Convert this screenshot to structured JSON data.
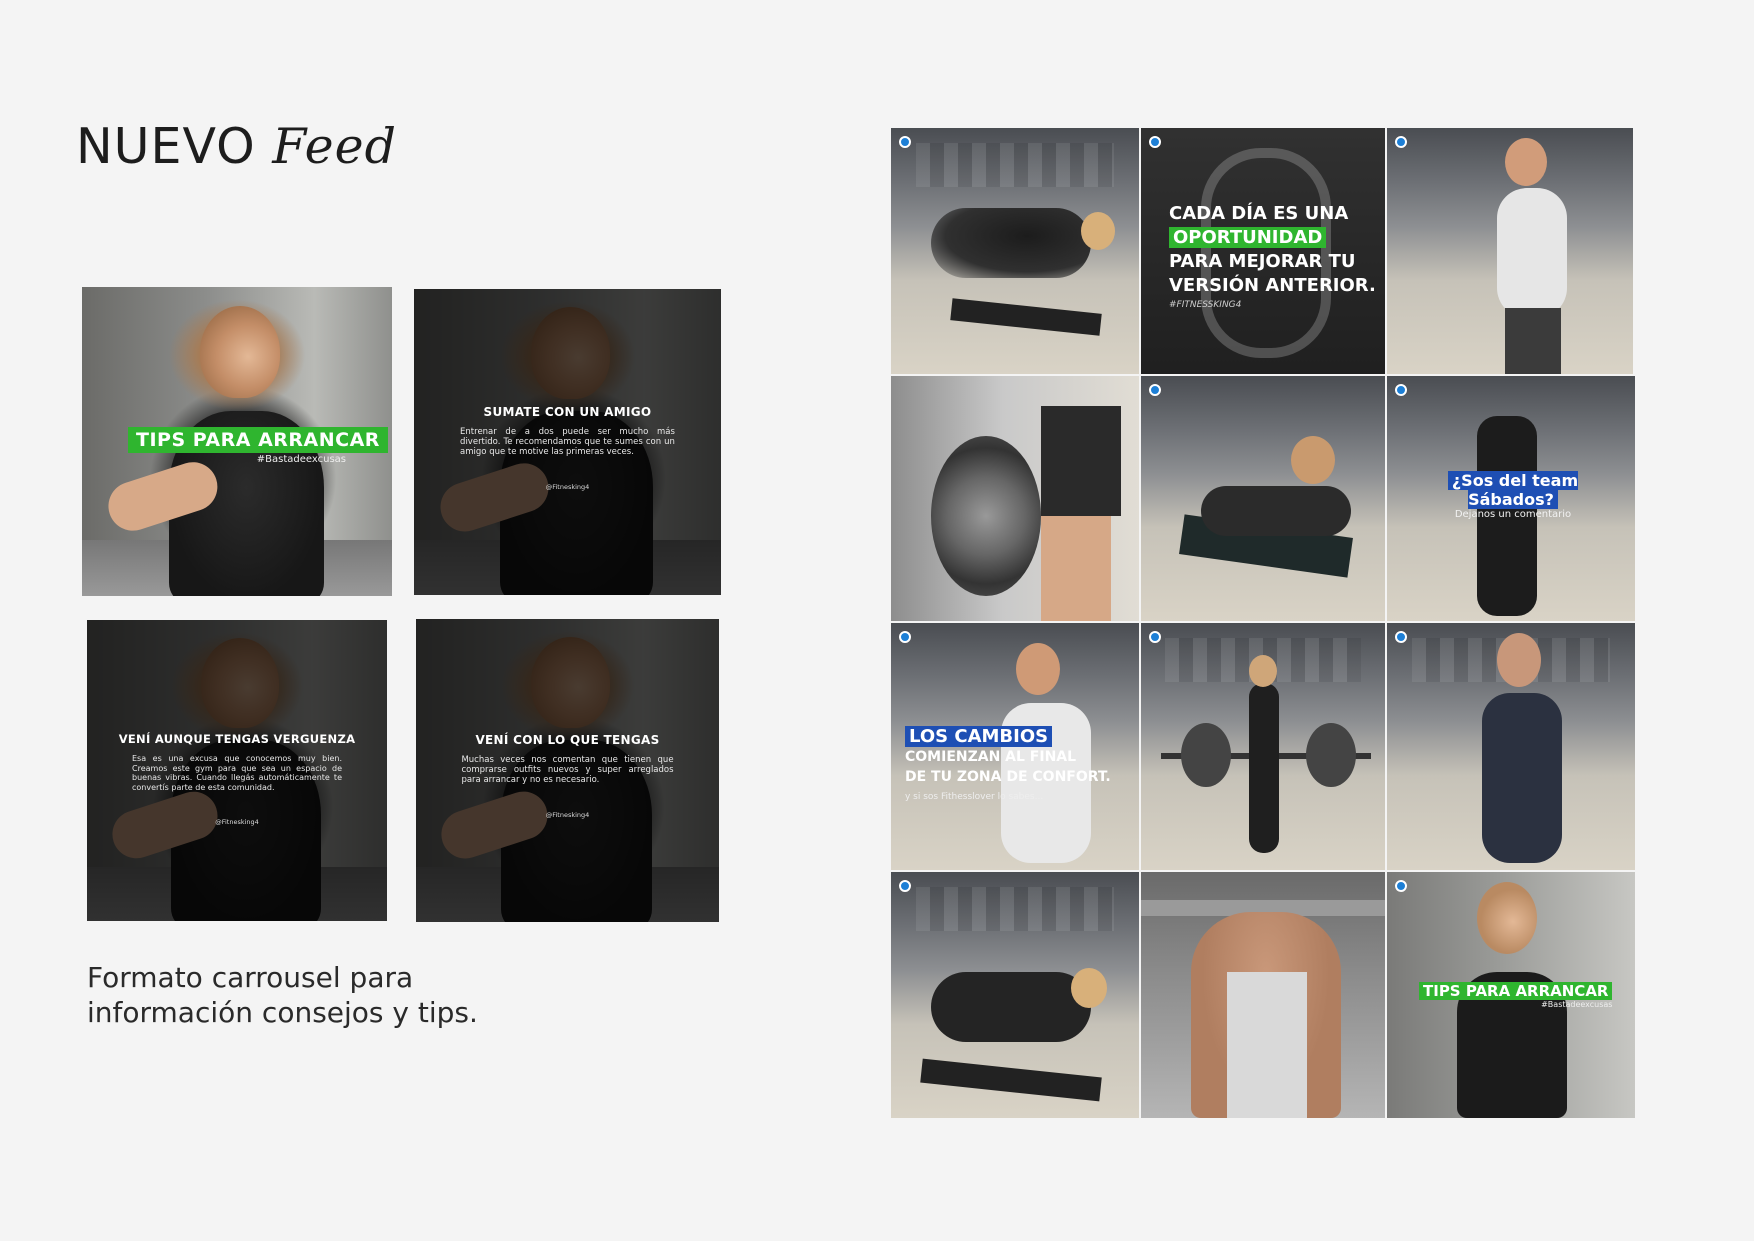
{
  "title": {
    "main": "NUEVO",
    "accent": "Feed"
  },
  "caption": {
    "line1": "Formato carrousel para",
    "line2": "información consejos y tips."
  },
  "carousel": {
    "card1": {
      "badge": "TIPS PARA ARRANCAR",
      "hashtag": "#Bastadeexcusas"
    },
    "card2": {
      "heading": "SUMATE CON UN AMIGO",
      "body": "Entrenar de a dos puede ser mucho más divertido. Te recomendamos que te sumes con un amigo que te motive las primeras veces.",
      "handle": "@Fitnesking4"
    },
    "card3": {
      "heading": "VENÍ AUNQUE TENGAS VERGUENZA",
      "body": "Esa es una excusa que conocemos muy bien. Creamos este gym para que sea un espacio de buenas vibras. Cuando llegás automáticamente te convertís parte de esta comunidad.",
      "handle": "@Fitnesking4"
    },
    "card4": {
      "heading": "VENÍ CON LO QUE TENGAS",
      "body": "Muchas veces nos comentan que tienen que comprarse outfits nuevos y super arreglados para arrancar y no es necesario.",
      "handle": "@Fitnesking4"
    }
  },
  "feed": {
    "tile2": {
      "line1": "CADA DÍA ES UNA",
      "line2": "OPORTUNIDAD",
      "line3": "PARA MEJORAR TU",
      "line4": "VERSIÓN ANTERIOR.",
      "hashtag": "#FITNESSKING4"
    },
    "tile6": {
      "question": "¿Sos del team Sábados?",
      "sub": "Dejanos un comentario"
    },
    "tile7": {
      "line1": "LOS CAMBIOS",
      "line2": "COMIENZAN AL FINAL",
      "line3": "DE TU ZONA DE CONFORT.",
      "sub": "y si sos Fithesslover lo sabes..."
    },
    "tile12": {
      "badge": "TIPS PARA ARRANCAR",
      "hashtag": "#Bastadeexcusas"
    }
  },
  "colors": {
    "green": "#2fb52f",
    "blue": "#1e4fb4",
    "background": "#f4f4f4"
  }
}
